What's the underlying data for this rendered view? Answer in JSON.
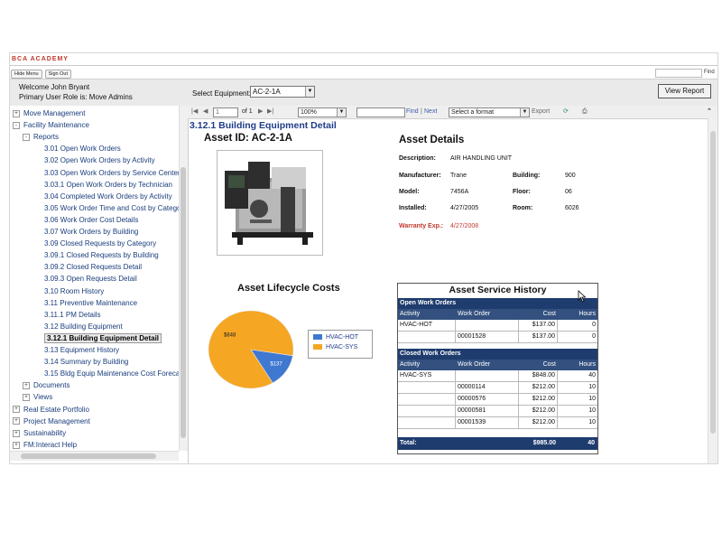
{
  "app": {
    "brand": "BCA ACADEMY",
    "top_buttons": [
      "Hide Menu",
      "Sign Out"
    ],
    "find_short": "Find"
  },
  "header": {
    "welcome_line": "Welcome John Bryant",
    "role_line": "Primary User Role is:  Move Admins",
    "select_label": "Select Equipment:",
    "select_value": "AC-2-1A",
    "view_report": "View Report"
  },
  "toolbar": {
    "page_value": "1",
    "page_of": "of 1",
    "zoom": "100%",
    "find": "Find",
    "separator": "|",
    "next": "Next",
    "format": "Select a format",
    "export": "Export"
  },
  "sidebar": {
    "items": [
      {
        "label": "Move Management",
        "level": 0,
        "toggle": "+"
      },
      {
        "label": "Facility Maintenance",
        "level": 0,
        "toggle": "-"
      },
      {
        "label": "Reports",
        "level": 1,
        "toggle": "-"
      },
      {
        "label": "3.01 Open Work Orders",
        "level": 2
      },
      {
        "label": "3.02 Open Work Orders by Activity",
        "level": 2
      },
      {
        "label": "3.03 Open Work Orders by Service Center",
        "level": 2
      },
      {
        "label": "3.03.1 Open Work Orders by Technician",
        "level": 2
      },
      {
        "label": "3.04 Completed Work Orders by Activity",
        "level": 2
      },
      {
        "label": "3.05 Work Order Time and Cost by Category",
        "level": 2
      },
      {
        "label": "3.06 Work Order Cost Details",
        "level": 2
      },
      {
        "label": "3.07 Work Orders by Building",
        "level": 2
      },
      {
        "label": "3.09 Closed Requests by Category",
        "level": 2
      },
      {
        "label": "3.09.1 Closed Requests by Building",
        "level": 2
      },
      {
        "label": "3.09.2 Closed Requests Detail",
        "level": 2
      },
      {
        "label": "3.09.3 Open Requests Detail",
        "level": 2
      },
      {
        "label": "3.10 Room History",
        "level": 2
      },
      {
        "label": "3.11 Preventive Maintenance",
        "level": 2
      },
      {
        "label": "3.11.1 PM Details",
        "level": 2
      },
      {
        "label": "3.12 Building Equipment",
        "level": 2
      },
      {
        "label": "3.12.1 Building Equipment Detail",
        "level": 2,
        "selected": true
      },
      {
        "label": "3.13 Equipment History",
        "level": 2
      },
      {
        "label": "3.14 Summary by Building",
        "level": 2
      },
      {
        "label": "3.15 Bldg Equip Maintenance Cost Forecast",
        "level": 2
      },
      {
        "label": "Documents",
        "level": 1,
        "toggle": "+"
      },
      {
        "label": "Views",
        "level": 1,
        "toggle": "+"
      },
      {
        "label": "Real Estate Portfolio",
        "level": 0,
        "toggle": "+"
      },
      {
        "label": "Project Management",
        "level": 0,
        "toggle": "+"
      },
      {
        "label": "Sustainability",
        "level": 0,
        "toggle": "+"
      },
      {
        "label": "FM:Interact Help",
        "level": 0,
        "toggle": "+"
      }
    ]
  },
  "report": {
    "title": "3.12.1 Building Equipment Detail",
    "asset_id_heading": "Asset ID: AC-2-1A",
    "details_heading": "Asset Details",
    "details": {
      "description_label": "Description:",
      "description": "AIR HANDLING UNIT",
      "manufacturer_label": "Manufacturer:",
      "manufacturer": "Trane",
      "building_label": "Building:",
      "building": "900",
      "model_label": "Model:",
      "model": "7456A",
      "floor_label": "Floor:",
      "floor": "06",
      "installed_label": "Installed:",
      "installed": "4/27/2005",
      "room_label": "Room:",
      "room": "6026",
      "warranty_label": "Warranty Exp.:",
      "warranty": "4/27/2008"
    },
    "lifecycle_heading": "Asset Lifecycle Costs",
    "service_heading": "Asset Service History",
    "open_section": "Open Work Orders",
    "closed_section": "Closed Work Orders",
    "columns": [
      "Activity",
      "Work Order",
      "Cost",
      "Hours"
    ],
    "open_rows": [
      [
        "HVAC-HOT",
        "",
        "$137.00",
        "0"
      ],
      [
        "",
        "00001528",
        "$137.00",
        "0"
      ]
    ],
    "closed_rows": [
      [
        "HVAC-SYS",
        "",
        "$848.00",
        "40"
      ],
      [
        "",
        "00000114",
        "$212.00",
        "10"
      ],
      [
        "",
        "00000576",
        "$212.00",
        "10"
      ],
      [
        "",
        "00000581",
        "$212.00",
        "10"
      ],
      [
        "",
        "00001539",
        "$212.00",
        "10"
      ]
    ],
    "total_label": "Total:",
    "total_cost": "$985.00",
    "total_hours": "40"
  },
  "chart_data": {
    "type": "pie",
    "title": "Asset Lifecycle Costs",
    "categories": [
      "HVAC-HOT",
      "HVAC-SYS"
    ],
    "values": [
      137,
      848
    ],
    "data_labels": [
      "$137",
      "$848"
    ],
    "colors": [
      "#3f78d0",
      "#f5a623"
    ],
    "legend": "right"
  }
}
